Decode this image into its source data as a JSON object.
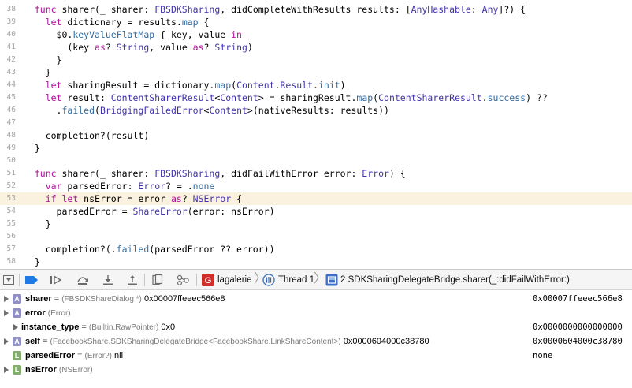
{
  "editor": {
    "lines": [
      {
        "num": "38",
        "highlight": false,
        "tokens": [
          [
            "p",
            "  "
          ],
          [
            "k",
            "func"
          ],
          [
            "p",
            " sharer(_ sharer: "
          ],
          [
            "t",
            "FBSDKSharing"
          ],
          [
            "p",
            ", didCompleteWithResults results: ["
          ],
          [
            "t",
            "AnyHashable"
          ],
          [
            "p",
            ": "
          ],
          [
            "t",
            "Any"
          ],
          [
            "p",
            "]?) {"
          ]
        ]
      },
      {
        "num": "39",
        "highlight": false,
        "tokens": [
          [
            "p",
            "    "
          ],
          [
            "k",
            "let"
          ],
          [
            "p",
            " dictionary = results."
          ],
          [
            "f",
            "map"
          ],
          [
            "p",
            " {"
          ]
        ]
      },
      {
        "num": "40",
        "highlight": false,
        "tokens": [
          [
            "p",
            "      $0."
          ],
          [
            "f",
            "keyValueFlatMap"
          ],
          [
            "p",
            " { key, value "
          ],
          [
            "k",
            "in"
          ]
        ]
      },
      {
        "num": "41",
        "highlight": false,
        "tokens": [
          [
            "p",
            "        (key "
          ],
          [
            "k",
            "as"
          ],
          [
            "p",
            "? "
          ],
          [
            "t",
            "String"
          ],
          [
            "p",
            ", value "
          ],
          [
            "k",
            "as"
          ],
          [
            "p",
            "? "
          ],
          [
            "t",
            "String"
          ],
          [
            "p",
            ")"
          ]
        ]
      },
      {
        "num": "42",
        "highlight": false,
        "tokens": [
          [
            "p",
            "      }"
          ]
        ]
      },
      {
        "num": "43",
        "highlight": false,
        "tokens": [
          [
            "p",
            "    }"
          ]
        ]
      },
      {
        "num": "44",
        "highlight": false,
        "tokens": [
          [
            "p",
            "    "
          ],
          [
            "k",
            "let"
          ],
          [
            "p",
            " sharingResult = dictionary."
          ],
          [
            "f",
            "map"
          ],
          [
            "p",
            "("
          ],
          [
            "t",
            "Content"
          ],
          [
            "p",
            "."
          ],
          [
            "t",
            "Result"
          ],
          [
            "p",
            "."
          ],
          [
            "f",
            "init"
          ],
          [
            "p",
            ")"
          ]
        ]
      },
      {
        "num": "45",
        "highlight": false,
        "tokens": [
          [
            "p",
            "    "
          ],
          [
            "k",
            "let"
          ],
          [
            "p",
            " result: "
          ],
          [
            "t",
            "ContentSharerResult"
          ],
          [
            "p",
            "<"
          ],
          [
            "t",
            "Content"
          ],
          [
            "p",
            "> = sharingResult."
          ],
          [
            "f",
            "map"
          ],
          [
            "p",
            "("
          ],
          [
            "t",
            "ContentSharerResult"
          ],
          [
            "p",
            "."
          ],
          [
            "f",
            "success"
          ],
          [
            "p",
            ") ??"
          ]
        ]
      },
      {
        "num": "46",
        "highlight": false,
        "tokens": [
          [
            "p",
            "      ."
          ],
          [
            "f",
            "failed"
          ],
          [
            "p",
            "("
          ],
          [
            "t",
            "BridgingFailedError"
          ],
          [
            "p",
            "<"
          ],
          [
            "t",
            "Content"
          ],
          [
            "p",
            ">(nativeResults: results))"
          ]
        ]
      },
      {
        "num": "47",
        "highlight": false,
        "tokens": []
      },
      {
        "num": "48",
        "highlight": false,
        "tokens": [
          [
            "p",
            "    completion?(result)"
          ]
        ]
      },
      {
        "num": "49",
        "highlight": false,
        "tokens": [
          [
            "p",
            "  }"
          ]
        ]
      },
      {
        "num": "50",
        "highlight": false,
        "tokens": []
      },
      {
        "num": "51",
        "highlight": false,
        "tokens": [
          [
            "p",
            "  "
          ],
          [
            "k",
            "func"
          ],
          [
            "p",
            " sharer(_ sharer: "
          ],
          [
            "t",
            "FBSDKSharing"
          ],
          [
            "p",
            ", didFailWithError error: "
          ],
          [
            "t",
            "Error"
          ],
          [
            "p",
            ") {"
          ]
        ]
      },
      {
        "num": "52",
        "highlight": false,
        "tokens": [
          [
            "p",
            "    "
          ],
          [
            "k",
            "var"
          ],
          [
            "p",
            " parsedError: "
          ],
          [
            "t",
            "Error"
          ],
          [
            "p",
            "? = ."
          ],
          [
            "f",
            "none"
          ]
        ]
      },
      {
        "num": "53",
        "highlight": true,
        "tokens": [
          [
            "p",
            "    "
          ],
          [
            "k",
            "if let"
          ],
          [
            "p",
            " nsError = error "
          ],
          [
            "k",
            "as"
          ],
          [
            "p",
            "? "
          ],
          [
            "t",
            "NSError"
          ],
          [
            "p",
            " {"
          ]
        ]
      },
      {
        "num": "54",
        "highlight": false,
        "tokens": [
          [
            "p",
            "      parsedError = "
          ],
          [
            "t",
            "ShareError"
          ],
          [
            "p",
            "(error: nsError)"
          ]
        ]
      },
      {
        "num": "55",
        "highlight": false,
        "tokens": [
          [
            "p",
            "    }"
          ]
        ]
      },
      {
        "num": "56",
        "highlight": false,
        "tokens": []
      },
      {
        "num": "57",
        "highlight": false,
        "tokens": [
          [
            "p",
            "    completion?(."
          ],
          [
            "f",
            "failed"
          ],
          [
            "p",
            "(parsedError ?? error))"
          ]
        ]
      },
      {
        "num": "58",
        "highlight": false,
        "tokens": [
          [
            "p",
            "  }"
          ]
        ]
      }
    ]
  },
  "debug_bar": {
    "icons": [
      "toggle-console-icon",
      "breakpoints-active-icon",
      "continue-icon",
      "step-over-icon",
      "step-into-icon",
      "step-out-icon",
      "view-hierarchy-icon",
      "memory-graph-icon",
      "location-icon"
    ],
    "app_name": "lagalerie",
    "thread_label": "Thread 1",
    "frame_number": "2",
    "frame_label": "2 SDKSharingDelegateBridge.sharer(_:didFailWithError:)"
  },
  "variables": [
    {
      "expand": true,
      "badge": "A",
      "name": "sharer",
      "eq": " = ",
      "type": "(FBSDKShareDialog *)",
      "value": "0x00007ffeeec566e8",
      "summary": "0x00007ffeeec566e8"
    },
    {
      "expand": true,
      "badge": "A",
      "name": "error",
      "eq": "",
      "type": "(Error)",
      "value": "",
      "summary": ""
    },
    {
      "expand": true,
      "badge": "",
      "name": "instance_type",
      "eq": " = ",
      "type": "(Builtin.RawPointer)",
      "value": "0x0",
      "summary": "0x0000000000000000"
    },
    {
      "expand": true,
      "badge": "A",
      "name": "self",
      "eq": " = ",
      "type": "(FacebookShare.SDKSharingDelegateBridge<FacebookShare.LinkShareContent>)",
      "value": "0x0000604000c38780",
      "summary": "0x0000604000c38780"
    },
    {
      "expand": false,
      "badge": "L",
      "name": "parsedError",
      "eq": " = ",
      "type": "(Error?)",
      "value": "nil",
      "summary": "none"
    },
    {
      "expand": true,
      "badge": "L",
      "name": "nsError",
      "eq": "",
      "type": "(NSError)",
      "value": "",
      "summary": ""
    }
  ],
  "colors": {
    "keyword": "#b10c9e",
    "type": "#4132ab",
    "function": "#2f6aa0",
    "current_line": "#fbf1df",
    "breakpoint_active": "#1f7ae6",
    "badge_argument": "#8f8fc4",
    "badge_local": "#82ad6e",
    "app_icon": "#d32d2a"
  }
}
